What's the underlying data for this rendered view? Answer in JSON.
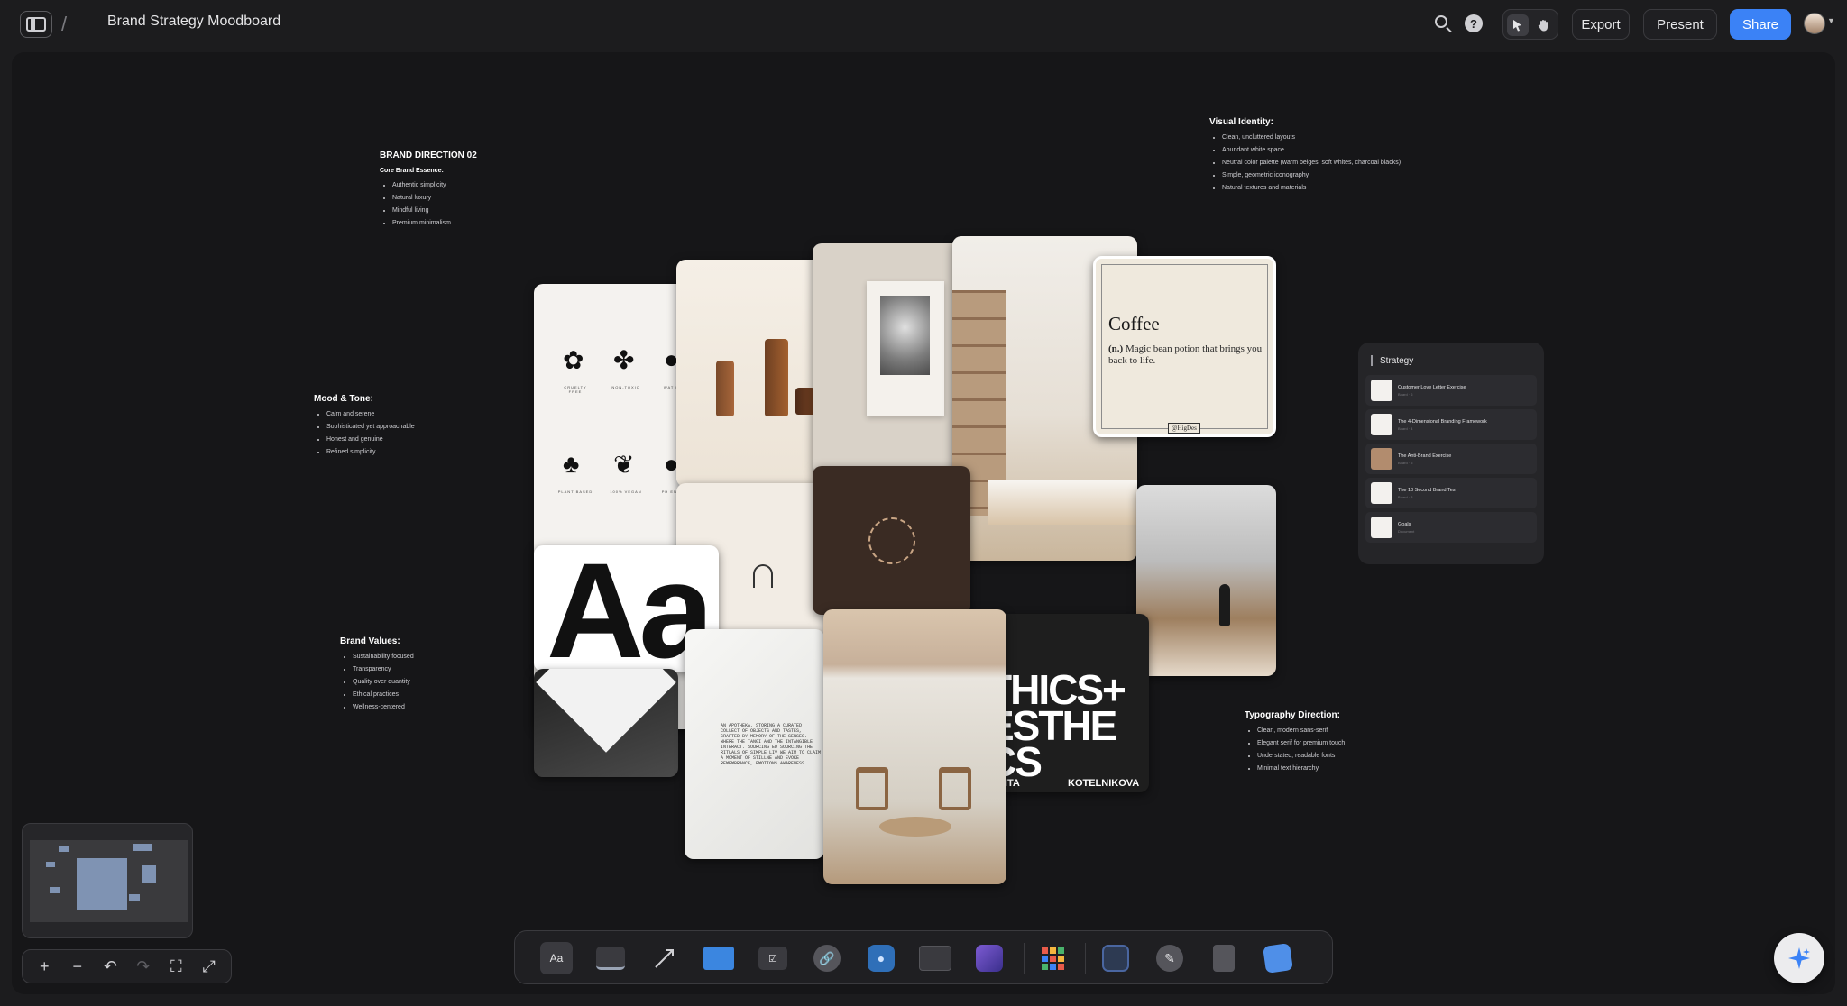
{
  "header": {
    "separator": "/",
    "board_title": "Brand Strategy Moodboard",
    "export_label": "Export",
    "present_label": "Present",
    "share_label": "Share",
    "help_glyph": "?"
  },
  "notes": {
    "brand_direction": {
      "title": "BRAND DIRECTION 02",
      "subtitle": "Core Brand Essence:",
      "items": [
        "Authentic simplicity",
        "Natural luxury",
        "Mindful living",
        "Premium minimalism"
      ]
    },
    "visual_identity": {
      "title": "Visual Identity:",
      "items": [
        "Clean, uncluttered layouts",
        "Abundant white space",
        "Neutral color palette (warm beiges, soft whites, charcoal blacks)",
        "Simple, geometric iconography",
        "Natural textures and materials"
      ]
    },
    "mood_tone": {
      "title": "Mood & Tone:",
      "items": [
        "Calm and serene",
        "Sophisticated yet approachable",
        "Honest and genuine",
        "Refined simplicity"
      ]
    },
    "brand_values": {
      "title": "Brand Values:",
      "items": [
        "Sustainability focused",
        "Transparency",
        "Quality over quantity",
        "Ethical practices",
        "Wellness-centered"
      ]
    },
    "typography": {
      "title": "Typography Direction:",
      "items": [
        "Clean, modern sans-serif",
        "Elegant serif for premium touch",
        "Understated, readable fonts",
        "Minimal text hierarchy"
      ]
    }
  },
  "cards": {
    "icon_labels": [
      "CRUELTY FREE",
      "NON-TOXIC",
      "WAT BASE",
      "PLANT BASED",
      "100% VEGAN",
      "PH ENERGY"
    ],
    "aa_text": "Aa",
    "coffee": {
      "title": "Coffee",
      "pos": "(n.)",
      "definition": "Magic bean potion that brings you back to life.",
      "tag": "@HigDes"
    },
    "paper_text": "AN APOTHEKA, STORING A CURATED COLLECT OF OBJECTS AND TASTES, CRAFTED BY MEMORY OF THE SENSES. WHERE THE TANGI AND THE INTANGIBLE INTERACT. SOURCING ED SOURCING THE RITUALS OF SIMPLE LIV WE AIM TO CLAIM A MOMENT OF STILLNE AND EVOKE REMEMBRANCE, EMOTIONS AWARENESS.",
    "aesthetics_lines": [
      "THICS+",
      "ESTHE",
      "CS"
    ],
    "aesthetics_names": [
      "ARITA",
      "KOTELNIKOVA"
    ]
  },
  "strategy": {
    "title": "Strategy",
    "items": [
      {
        "label": "Customer Love Letter Exercise",
        "meta": "Board · 6"
      },
      {
        "label": "The 4-Dimensional Branding Framework",
        "meta": "Board · 4"
      },
      {
        "label": "The Anti-Brand Exercise",
        "meta": "Board · 5"
      },
      {
        "label": "The 10 Second Brand Test",
        "meta": "Board · 3"
      },
      {
        "label": "Goals",
        "meta": "Document"
      }
    ]
  },
  "toolbar": {
    "text_tool_label": "Aa"
  },
  "colors": {
    "accent": "#3b82f6",
    "background": "#1c1c1e",
    "canvas": "#161618"
  }
}
